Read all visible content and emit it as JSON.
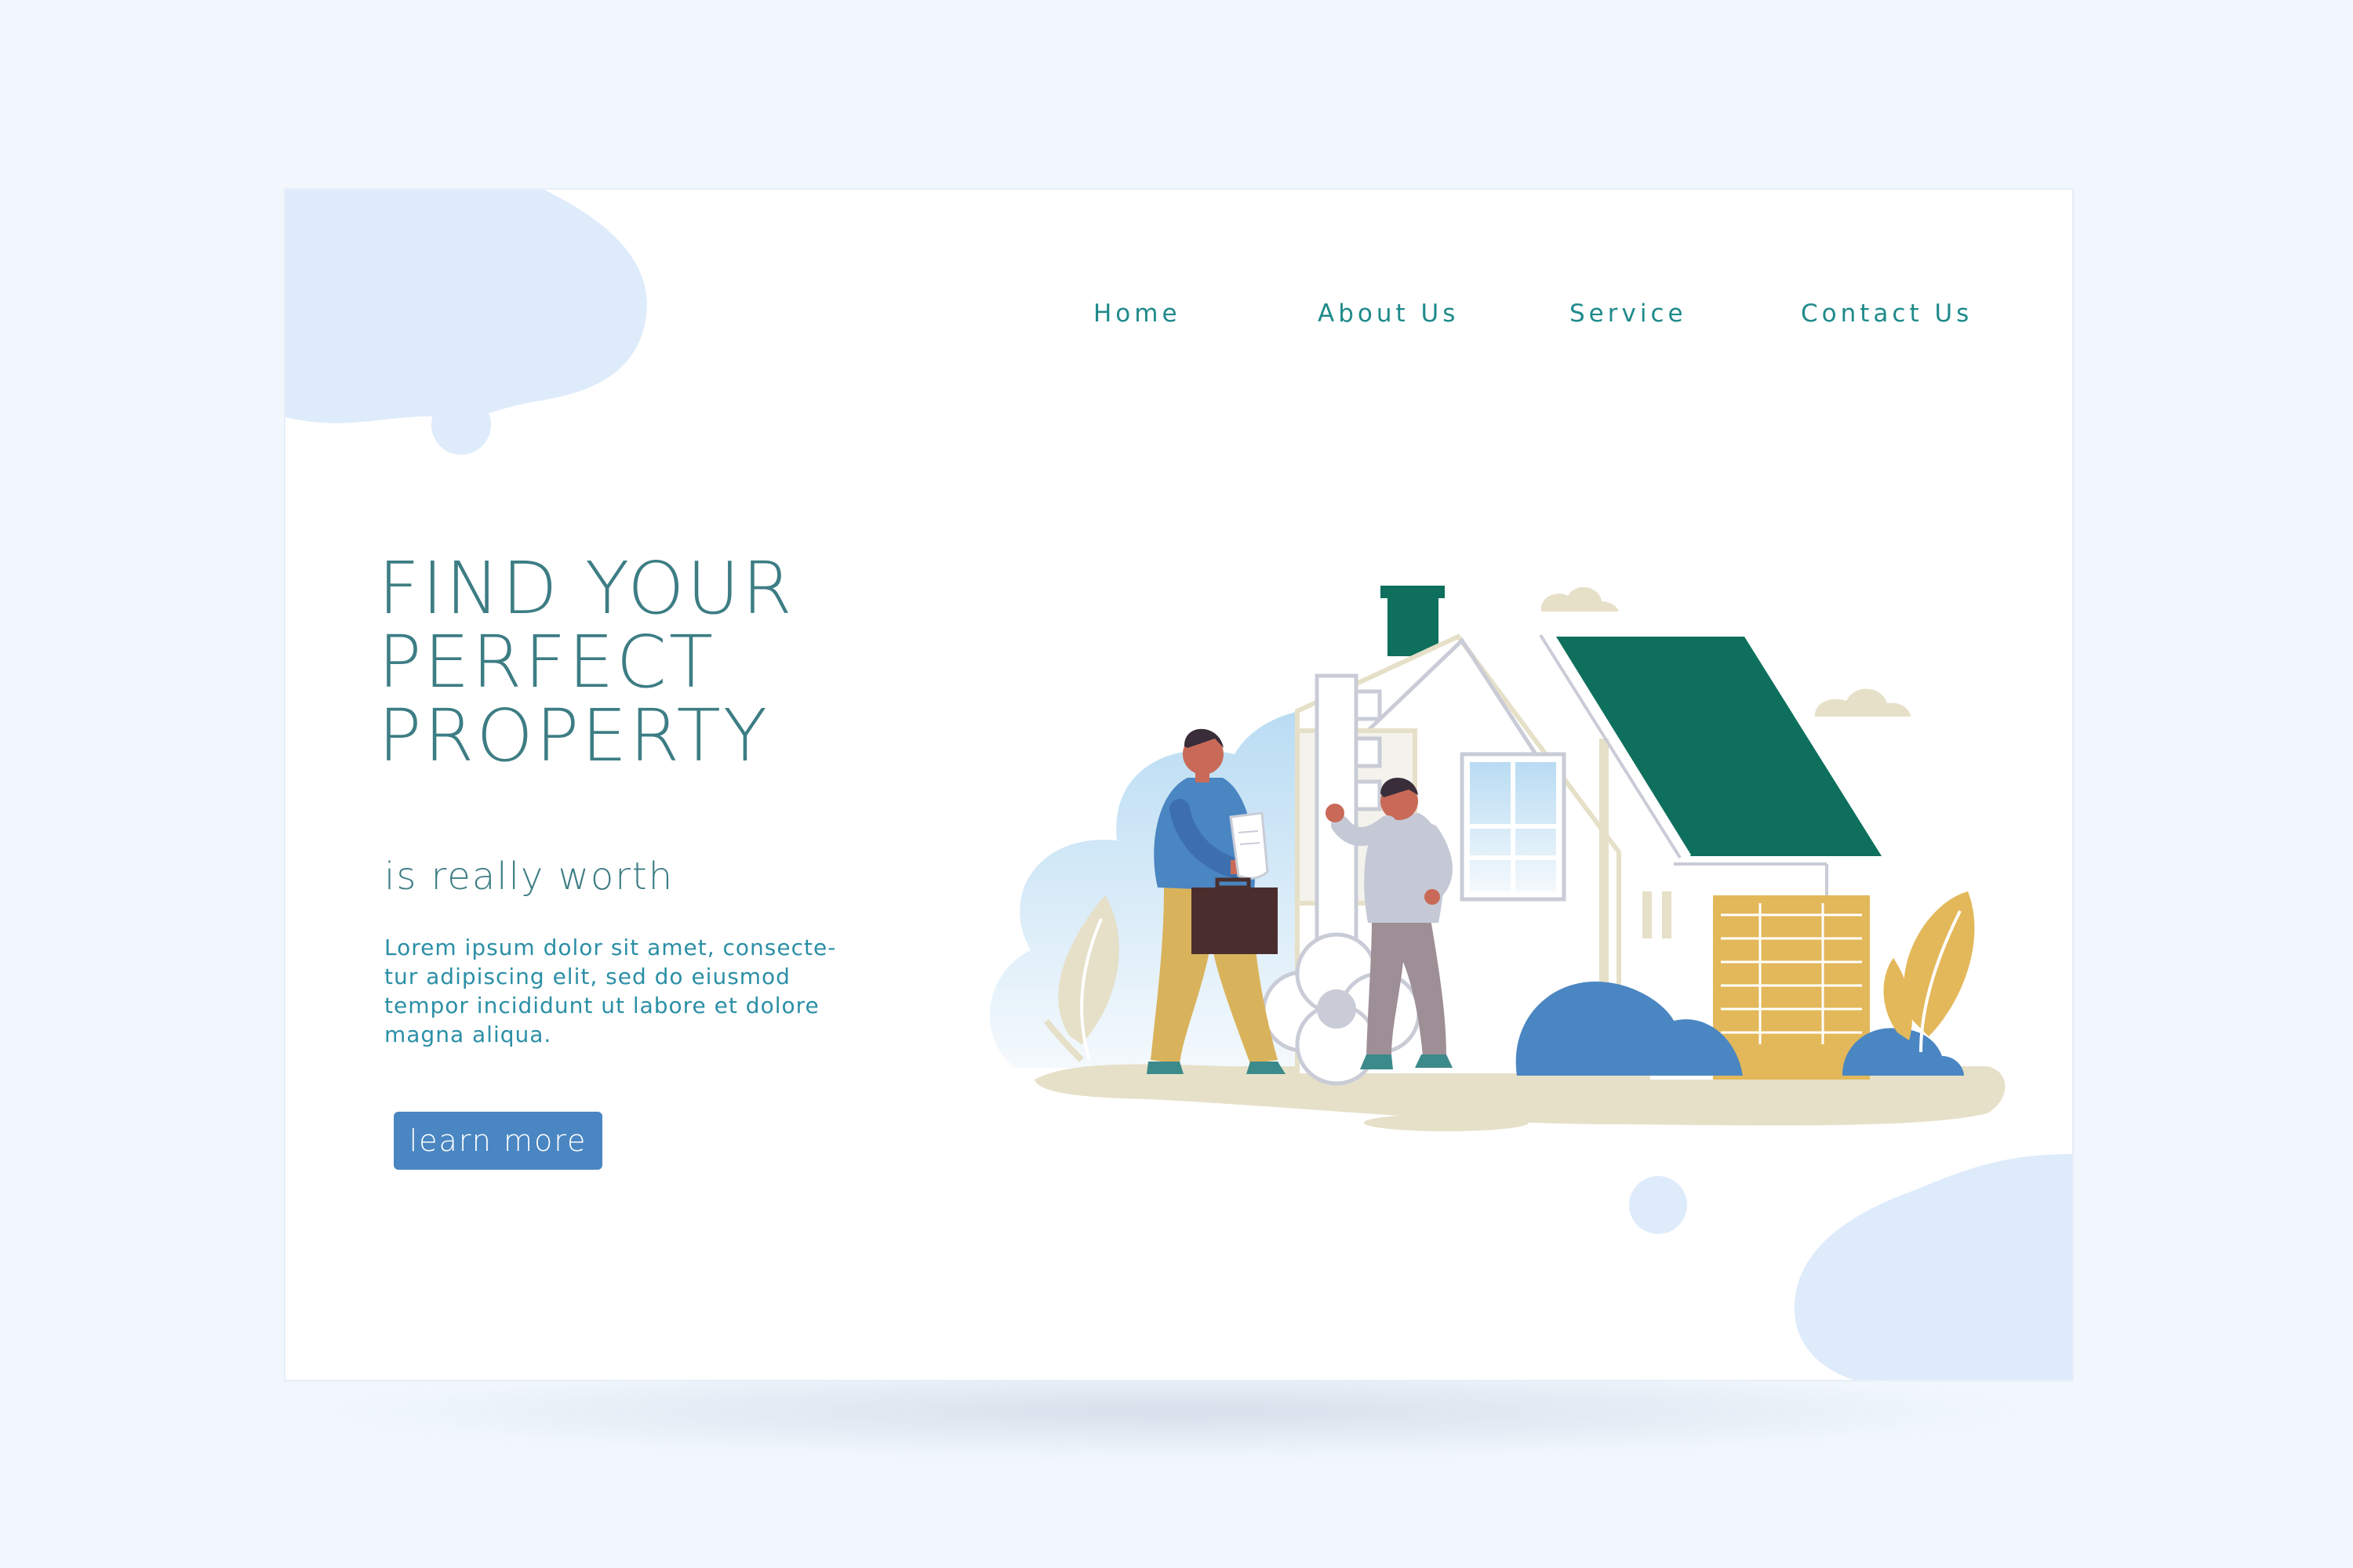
{
  "nav": {
    "items": [
      "Home",
      "About Us",
      "Service",
      "Contact Us"
    ]
  },
  "hero": {
    "title_lines": [
      "FIND YOUR",
      "PERFECT",
      "PROPERTY"
    ],
    "subtitle": "is really worth",
    "body_lines": [
      "Lorem ipsum dolor sit amet, consecte-",
      "tur adipiscing elit, sed do eiusmod",
      "tempor incididunt ut labore et dolore",
      "magna aliqua."
    ],
    "button_label": "learn more"
  },
  "colors": {
    "background": "#f1f7fd",
    "nav_text": "#1f8a8a",
    "heading": "#3d7d84",
    "body_text": "#2b8fa6",
    "button": "#4a86c2",
    "roof": "#0e6f5d",
    "blob": "#deebfb",
    "bush": "#4a86c2",
    "plant": "#e3b85a",
    "ground": "#e6e0c8"
  },
  "icons": [
    "key-icon",
    "house-icon",
    "document-icon",
    "briefcase-icon",
    "cloud-icon",
    "plant-icon",
    "bush-icon"
  ]
}
